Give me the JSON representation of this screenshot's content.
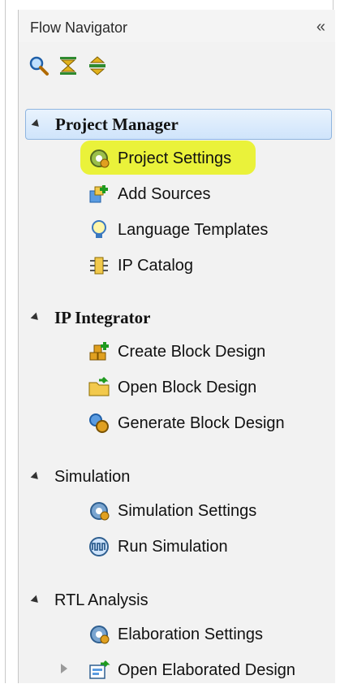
{
  "panel": {
    "title": "Flow Navigator",
    "collapse_glyph": "«"
  },
  "toolbar": {
    "icons": [
      "search-icon",
      "collapse-all-icon",
      "expand-all-icon"
    ]
  },
  "sections": [
    {
      "label": "Project Manager",
      "selected": true,
      "items": [
        "Project Settings",
        "Add Sources",
        "Language Templates",
        "IP Catalog"
      ]
    },
    {
      "label": "IP Integrator",
      "items": [
        "Create Block Design",
        "Open Block Design",
        "Generate Block Design"
      ]
    },
    {
      "label": "Simulation",
      "items": [
        "Simulation Settings",
        "Run Simulation"
      ]
    },
    {
      "label": "RTL Analysis",
      "items": [
        "Elaboration Settings",
        "Open Elaborated Design"
      ]
    }
  ],
  "colors": {
    "highlight": "#e9f21a",
    "selection": "#cfe4fb"
  }
}
